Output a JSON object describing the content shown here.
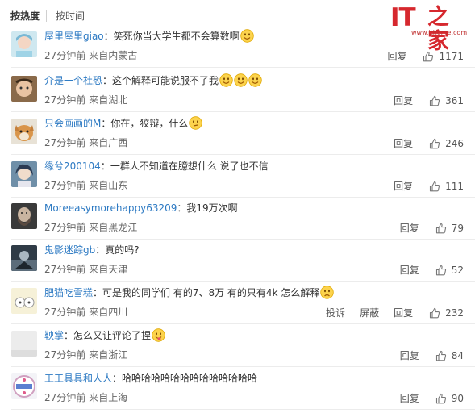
{
  "tabs": {
    "hot": "按热度",
    "time": "按时间"
  },
  "logo": {
    "it": "IT",
    "cn": "之家",
    "url": "www.ithome.com"
  },
  "comments": [
    {
      "user": "屋里屋里giao",
      "text": "笑死你当大学生都不会算数啊",
      "emoji": 1,
      "emoji_type": "smile",
      "time": "27分钟前",
      "loc": "来自内蒙古",
      "reply": "回复",
      "likes": "1171",
      "avatar": "cartoon"
    },
    {
      "user": "介是一个杜恐",
      "text": "这个解释可能说服不了我",
      "emoji": 3,
      "emoji_type": "smile",
      "time": "27分钟前",
      "loc": "来自湖北",
      "reply": "回复",
      "likes": "361",
      "avatar": "baby"
    },
    {
      "user": "只会画画的M",
      "text": "你在，狡辩，什么",
      "emoji": 1,
      "emoji_type": "think",
      "time": "27分钟前",
      "loc": "来自广西",
      "reply": "回复",
      "likes": "246",
      "avatar": "dog"
    },
    {
      "user": "缘兮200104",
      "text": "一群人不知道在臆想什么 说了也不信",
      "emoji": 0,
      "emoji_type": "",
      "time": "27分钟前",
      "loc": "来自山东",
      "reply": "回复",
      "likes": "111",
      "avatar": "anime"
    },
    {
      "user": "Moreeasymorehappy63209",
      "text": "我19万次啊",
      "emoji": 0,
      "emoji_type": "",
      "time": "27分钟前",
      "loc": "来自黑龙江",
      "reply": "回复",
      "likes": "79",
      "avatar": "beard"
    },
    {
      "user": "鬼影迷踪gb",
      "text": "真的吗?",
      "emoji": 0,
      "emoji_type": "",
      "time": "27分钟前",
      "loc": "来自天津",
      "reply": "回复",
      "likes": "52",
      "avatar": "game"
    },
    {
      "user": "肥猫吃雪糕",
      "text": "可是我的同学们 有的7、8万 有的只有4k 怎么解释",
      "emoji": 1,
      "emoji_type": "sad",
      "time": "27分钟前",
      "loc": "来自四川",
      "report": "投诉",
      "block": "屏蔽",
      "reply": "回复",
      "likes": "232",
      "avatar": "cat"
    },
    {
      "user": "鞅掌",
      "text": "怎么又让评论了捏",
      "emoji": 1,
      "emoji_type": "tongue",
      "time": "27分钟前",
      "loc": "来自浙江",
      "reply": "回复",
      "likes": "84",
      "avatar": "blank"
    },
    {
      "user": "工工具具和人人",
      "text": "哈哈哈哈哈哈哈哈哈哈哈哈哈哈",
      "emoji": 0,
      "emoji_type": "",
      "time": "27分钟前",
      "loc": "来自上海",
      "reply": "回复",
      "likes": "90",
      "avatar": "badge"
    }
  ],
  "colors": {
    "username": "#2d7ac3",
    "logo_red": "#d6282e",
    "meta": "#666666"
  }
}
